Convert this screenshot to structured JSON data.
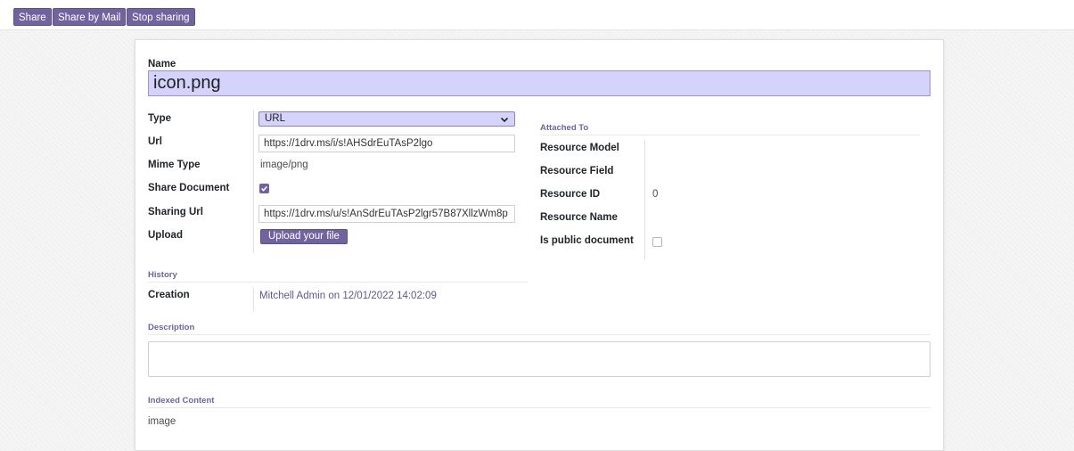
{
  "toolbar": {
    "share_label": "Share",
    "share_mail_label": "Share by Mail",
    "stop_sharing_label": "Stop sharing"
  },
  "form": {
    "name_label": "Name",
    "name_value": "icon.png",
    "type_label": "Type",
    "type_value": "URL",
    "url_label": "Url",
    "url_value": "https://1drv.ms/i/s!AHSdrEuTAsP2lgo",
    "mime_label": "Mime Type",
    "mime_value": "image/png",
    "share_doc_label": "Share Document",
    "share_doc_checked": true,
    "sharing_url_label": "Sharing Url",
    "sharing_url_value": "https://1drv.ms/u/s!AnSdrEuTAsP2lgr57B87XllzWm8p",
    "upload_label": "Upload",
    "upload_button": "Upload your file"
  },
  "attached": {
    "section_title": "Attached To",
    "resource_model_label": "Resource Model",
    "resource_model_value": "",
    "resource_field_label": "Resource Field",
    "resource_field_value": "",
    "resource_id_label": "Resource ID",
    "resource_id_value": "0",
    "resource_name_label": "Resource Name",
    "resource_name_value": "",
    "public_label": "Is public document",
    "public_checked": false
  },
  "history": {
    "section_title": "History",
    "creation_label": "Creation",
    "creation_value": "Mitchell Admin on 12/01/2022 14:02:09"
  },
  "description": {
    "section_title": "Description",
    "value": ""
  },
  "indexed": {
    "section_title": "Indexed Content",
    "value": "image"
  },
  "colors": {
    "accent": "#71639e",
    "input_highlight": "#d5d2fb"
  }
}
